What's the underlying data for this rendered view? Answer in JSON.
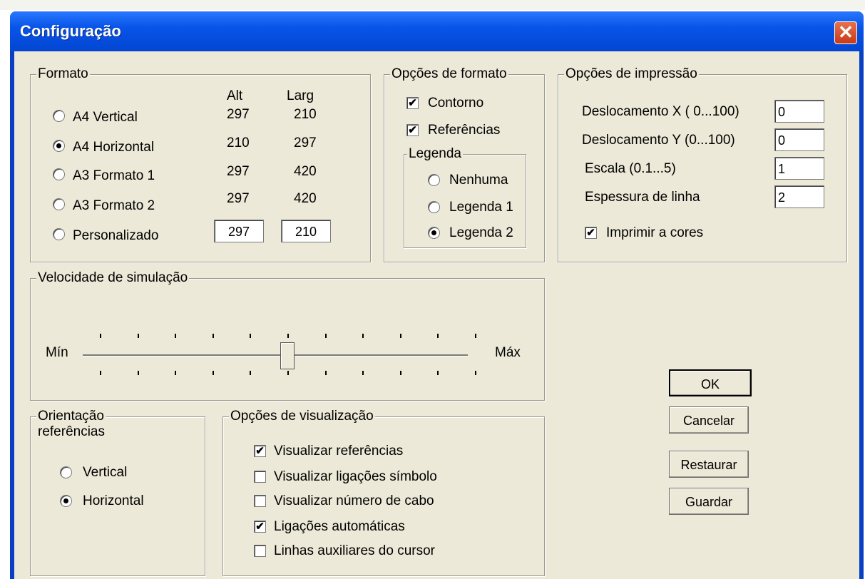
{
  "window": {
    "title": "Configuração",
    "close_symbol": "✕"
  },
  "formato": {
    "label": "Formato",
    "col_alt": "Alt",
    "col_larg": "Larg",
    "rows": [
      {
        "label": "A4 Vertical",
        "alt": "297",
        "larg": "210",
        "selected": false
      },
      {
        "label": "A4 Horizontal",
        "alt": "210",
        "larg": "297",
        "selected": true
      },
      {
        "label": "A3 Formato 1",
        "alt": "297",
        "larg": "420",
        "selected": false
      },
      {
        "label": "A3 Formato 2",
        "alt": "297",
        "larg": "420",
        "selected": false
      }
    ],
    "custom": {
      "label": "Personalizado",
      "alt_value": "297",
      "larg_value": "210",
      "selected": false
    }
  },
  "opcoes_formato": {
    "label": "Opções de formato",
    "contorno": {
      "label": "Contorno",
      "checked": true
    },
    "referencias": {
      "label": "Referências",
      "checked": true
    },
    "legenda": {
      "label": "Legenda",
      "options": [
        {
          "label": "Nenhuma",
          "selected": false
        },
        {
          "label": "Legenda 1",
          "selected": false
        },
        {
          "label": "Legenda 2",
          "selected": true
        }
      ]
    }
  },
  "opcoes_impressao": {
    "label": "Opções de impressão",
    "desloc_x": {
      "label": "Deslocamento  X ( 0...100)",
      "value": "0"
    },
    "desloc_y": {
      "label": "Deslocamento  Y (0...100)",
      "value": "0"
    },
    "escala": {
      "label": "Escala (0.1...5)",
      "value": "1"
    },
    "espessura": {
      "label": "Espessura de linha",
      "value": "2"
    },
    "cores": {
      "label": "Imprimir a cores",
      "checked": true
    }
  },
  "velocidade": {
    "label": "Velocidade de simulação",
    "min_label": "Mín",
    "max_label": "Máx",
    "tick_count": 11,
    "value_fraction": 0.5
  },
  "orientacao": {
    "label_line1": "Orientação",
    "label_line2": "referências",
    "options": [
      {
        "label": "Vertical",
        "selected": false
      },
      {
        "label": "Horizontal",
        "selected": true
      }
    ]
  },
  "visualizacao": {
    "label": "Opções de visualização",
    "items": [
      {
        "label": "Visualizar referências",
        "checked": true
      },
      {
        "label": "Visualizar ligações símbolo",
        "checked": false
      },
      {
        "label": "Visualizar número de cabo",
        "checked": false
      },
      {
        "label": "Ligações automáticas",
        "checked": true
      },
      {
        "label": "Linhas auxiliares do cursor",
        "checked": false
      }
    ]
  },
  "buttons": {
    "ok": "OK",
    "cancelar": "Cancelar",
    "restaurar": "Restaurar",
    "guardar": "Guardar"
  },
  "check_mark": "✔"
}
